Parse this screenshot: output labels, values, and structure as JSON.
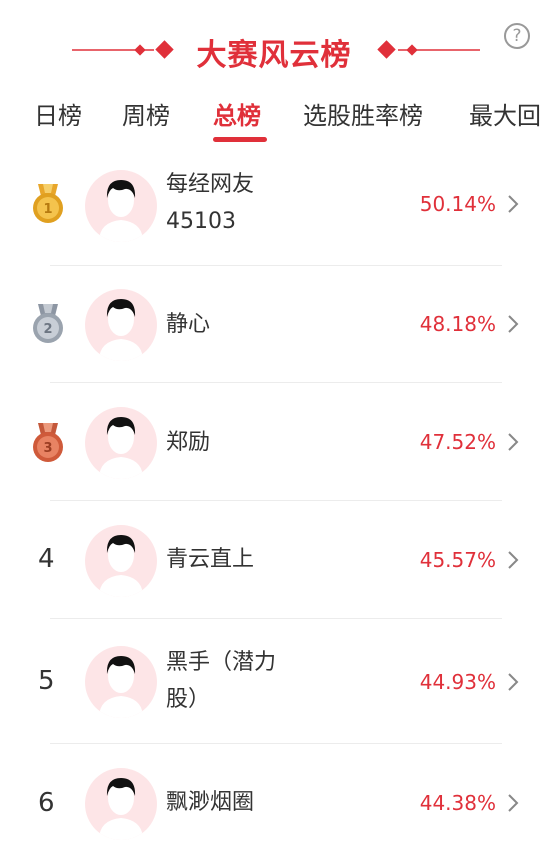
{
  "header": {
    "title": "大赛风云榜",
    "help_icon": "?"
  },
  "tabs": [
    {
      "label": "日榜",
      "active": false
    },
    {
      "label": "周榜",
      "active": false
    },
    {
      "label": "总榜",
      "active": true
    },
    {
      "label": "选股胜率榜",
      "active": false
    },
    {
      "label": "最大回",
      "active": false
    }
  ],
  "ranking": [
    {
      "rank": "1",
      "badge": "gold-medal",
      "name_line1": "每经网友",
      "name_line2": "45103",
      "rate": "50.14%"
    },
    {
      "rank": "2",
      "badge": "silver-medal",
      "name_line1": "静心",
      "name_line2": "",
      "rate": "48.18%"
    },
    {
      "rank": "3",
      "badge": "bronze-medal",
      "name_line1": "郑励",
      "name_line2": "",
      "rate": "47.52%"
    },
    {
      "rank": "4",
      "badge": "",
      "name_line1": "青云直上",
      "name_line2": "",
      "rate": "45.57%"
    },
    {
      "rank": "5",
      "badge": "",
      "name_line1": "黑手（潜力",
      "name_line2": "股）",
      "rate": "44.93%"
    },
    {
      "rank": "6",
      "badge": "",
      "name_line1": "飘渺烟圈",
      "name_line2": "",
      "rate": "44.38%"
    }
  ],
  "colors": {
    "accent": "#e0303a",
    "gold": "#e0a020",
    "silver": "#9aa3ae",
    "bronze": "#cf5a3a",
    "avatar_bg": "#fde5e7"
  }
}
